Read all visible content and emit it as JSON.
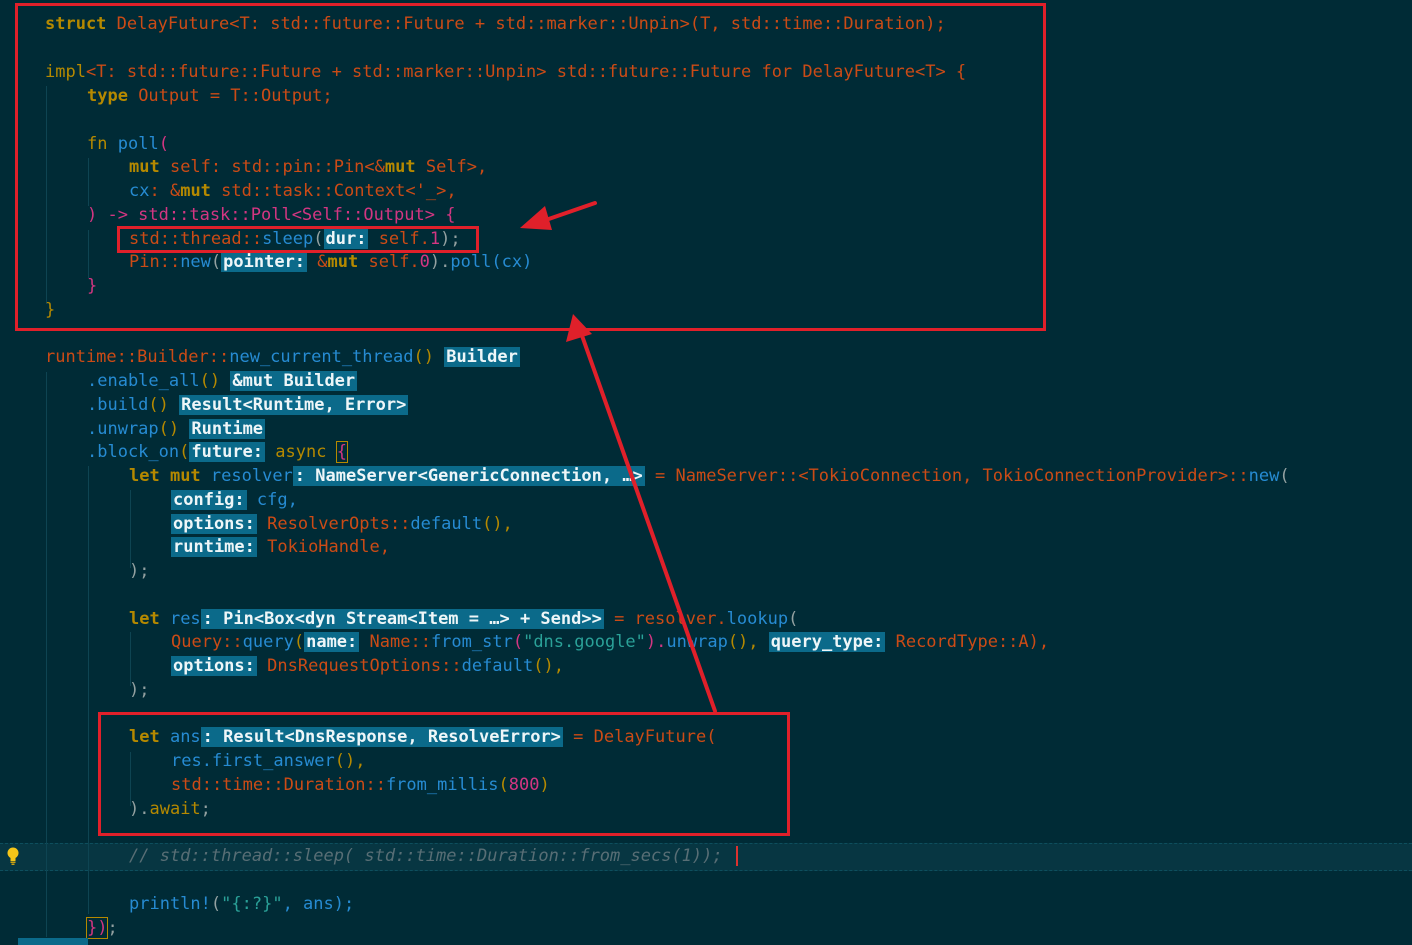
{
  "code": {
    "l1": {
      "a": "struct",
      "b": "DelayFuture",
      "c": "<T: std::future::Future + std::marker::Unpin>(T, std::time::Duration);"
    },
    "l2": {
      "a": "impl",
      "b": "<T: std::future::Future + std::marker::Unpin> std::future::Future for DelayFuture<T> {"
    },
    "l3": {
      "a": "type",
      "b": " Output = T::Output;"
    },
    "l4": {
      "a": "fn",
      "b": "poll",
      "c": "("
    },
    "l5": {
      "a": "mut",
      "b": " self: std::pin::Pin<&",
      "c": "mut",
      "d": " Self>,"
    },
    "l6": {
      "a": "cx",
      "b": ": &",
      "c": "mut",
      "d": " std::task::Context<'_>,"
    },
    "l7": {
      "a": ") -> std::task::Poll<Self::Output> {"
    },
    "l8": {
      "a": "std::thread::",
      "b": "sleep",
      "c": "(",
      "hint": "dur:",
      "d": " self.",
      "e": "1",
      "f": ");"
    },
    "l9": {
      "a": "Pin::",
      "b": "new",
      "c": "(",
      "hint": "pointer:",
      "d": " &",
      "e": "mut",
      "f": " self.",
      "g": "0",
      ".h": "",
      "h": ").",
      "i": "poll",
      "j": "(cx)"
    },
    "l10": {
      "a": "}"
    },
    "l11": {
      "a": "}"
    },
    "l12": {
      "a": "runtime::Builder::",
      "b": "new_current_thread",
      "c": "()",
      "hint": "Builder"
    },
    "l13": {
      "a": ".enable_all",
      "b": "()",
      "hint": "&mut Builder"
    },
    "l14": {
      "a": ".build",
      "b": "()",
      "hint": "Result<Runtime, Error>"
    },
    "l15": {
      "a": ".unwrap",
      "b": "()",
      "hint": "Runtime"
    },
    "l16": {
      "a": ".block_on",
      "b": "(",
      "hint": "future:",
      "c": " async ",
      "d": "{"
    },
    "l17": {
      "a": "let",
      "b": " mut",
      "c": " resolver",
      "hint": ": NameServer<GenericConnection, …>",
      "d": " = NameServer::<TokioConnection, TokioConnectionProvider>::",
      "e": "new",
      "f": "("
    },
    "l18": {
      "hint": "config:",
      "a": " cfg,"
    },
    "l19": {
      "hint": "options:",
      "a": " ResolverOpts::",
      "b": "default",
      "c": "(),"
    },
    "l20": {
      "hint": "runtime:",
      "a": " TokioHandle,"
    },
    "l21": {
      "a": ");"
    },
    "l22": {
      "a": "let",
      "b": " res",
      "hint": ": Pin<Box<dyn Stream<Item = …> + Send>>",
      "c": " = resolver.",
      "d": "lookup",
      "e": "("
    },
    "l23": {
      "a": "Query::",
      "b": "query",
      "c": "(",
      "hint": "name:",
      "d": " Name::",
      "e": "from_str",
      "f": "(",
      "g": "\"dns.google\"",
      "h": ").",
      "i": "unwrap",
      "j": "(), ",
      "hint2": "query_type:",
      "k": " RecordType::A),"
    },
    "l24": {
      "hint": "options:",
      "a": " DnsRequestOptions::",
      "b": "default",
      "c": "(),"
    },
    "l25": {
      "a": ");"
    },
    "l26": {
      "a": "let",
      "b": " ans",
      "hint": ": Result<DnsResponse, ResolveError>",
      "c": " = DelayFuture("
    },
    "l27": {
      "a": "res.",
      "b": "first_answer",
      "c": "(),"
    },
    "l28": {
      "a": "std::time::Duration::",
      "b": "from_millis",
      "c": "(",
      "d": "800",
      "e": ")"
    },
    "l29": {
      "a": ").",
      "b": "await",
      ";": "",
      "c": ";"
    },
    "l30": {
      "a": "// std::thread::sleep( std::time::Duration::from_secs(1));"
    },
    "l31": {
      "a": "println!",
      "b": "(",
      "c": "\"{:?}\"",
      "d": ", ans);"
    },
    "l32": {
      "a": "})",
      "b": ";"
    }
  },
  "icons": {
    "bulb": "lightbulb-icon"
  },
  "colors": {
    "annotation": "#e0202a",
    "background": "#002b36",
    "hint_bg": "#0b6a8a"
  }
}
